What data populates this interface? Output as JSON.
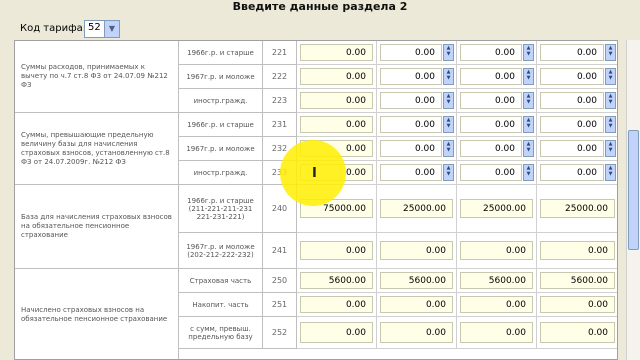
{
  "title": "Введите данные раздела 2",
  "tariff": {
    "label": "Код тарифа:",
    "value": "52"
  },
  "groups": [
    {
      "text": "Суммы расходов, принимаемых к вычету по ч.7 ст.8 ФЗ от 24.07.09 №212 ФЗ"
    },
    {
      "text": "Суммы, превышающие предельную величину базы для начисления страховых взносов, установленную ст.8 ФЗ от 24.07.2009г. №212 ФЗ"
    },
    {
      "text": "База для начисления страховых взносов на обязательное пенсионное страхование"
    },
    {
      "text": "Начислено страховых взносов на обязательное пенсионное страхование"
    }
  ],
  "rows": [
    {
      "sub": "1966г.р. и старше",
      "code": "221",
      "values": [
        "0.00",
        "0.00",
        "0.00",
        "0.00"
      ]
    },
    {
      "sub": "1967г.р. и моложе",
      "code": "222",
      "values": [
        "0.00",
        "0.00",
        "0.00",
        "0.00"
      ]
    },
    {
      "sub": "иностр.гражд.",
      "code": "223",
      "values": [
        "0.00",
        "0.00",
        "0.00",
        "0.00"
      ]
    },
    {
      "sub": "1966г.р. и старше",
      "code": "231",
      "values": [
        "0.00",
        "0.00",
        "0.00",
        "0.00"
      ]
    },
    {
      "sub": "1967г.р. и моложе",
      "code": "232",
      "values": [
        "0.00",
        "0.00",
        "0.00",
        "0.00"
      ]
    },
    {
      "sub": "иностр.гражд.",
      "code": "233",
      "values": [
        "0.00",
        "0.00",
        "0.00",
        "0.00"
      ]
    },
    {
      "sub": "1966г.р. и старше (211-221-211-231 221-231-221)",
      "code": "240",
      "values": [
        "75000.00",
        "25000.00",
        "25000.00",
        "25000.00"
      ]
    },
    {
      "sub": "1967г.р. и моложе (202-212-222-232)",
      "code": "241",
      "values": [
        "0.00",
        "0.00",
        "0.00",
        "0.00"
      ]
    },
    {
      "sub": "Страховая часть",
      "code": "250",
      "values": [
        "5600.00",
        "5600.00",
        "5600.00",
        "5600.00"
      ]
    },
    {
      "sub": "Накопит. часть",
      "code": "251",
      "values": [
        "0.00",
        "0.00",
        "0.00",
        "0.00"
      ]
    },
    {
      "sub": "с сумм, превыш. предельную базу",
      "code": "252",
      "values": [
        "0.00",
        "0.00",
        "0.00",
        "0.00"
      ]
    }
  ],
  "colors": {
    "input_bg": "#ffffe8",
    "accent": "#c1d3fb",
    "highlight": "#ffee00"
  },
  "icons": {
    "spin": "spin-icon",
    "dropdown": "chevron-down-icon",
    "cursor": "text-cursor-icon"
  }
}
